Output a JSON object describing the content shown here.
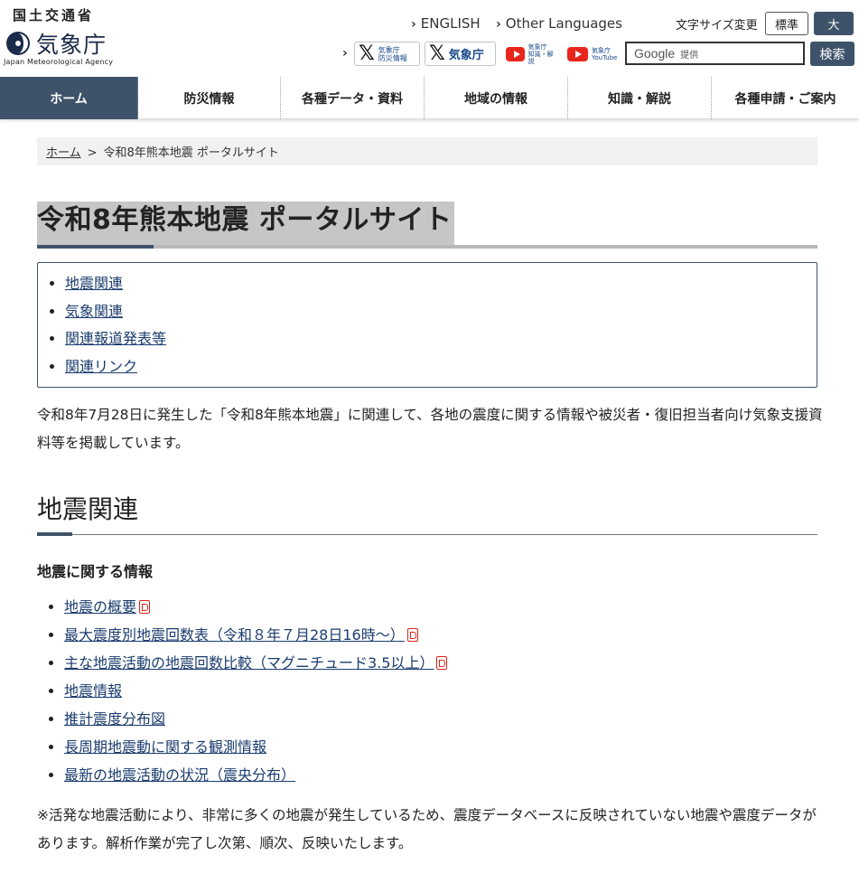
{
  "header": {
    "ministry": "国土交通省",
    "agency_name": "気象庁",
    "agency_english": "Japan Meteorological Agency",
    "english_link": "ENGLISH",
    "other_languages_link": "Other Languages",
    "font_size_label": "文字サイズ変更",
    "font_standard": "標準",
    "font_large": "大",
    "sns": [
      {
        "icon": "x-icon",
        "label_line1": "気象庁",
        "label_line2": "防災情報"
      },
      {
        "icon": "x-icon",
        "label": "気象庁"
      },
      {
        "icon": "youtube-icon",
        "label_line1": "気象庁",
        "label_line2": "知識・解説"
      },
      {
        "icon": "youtube-icon",
        "label_line1": "気象庁",
        "label_line2": "YouTube"
      }
    ],
    "search_google": "Google",
    "search_provided": "提供",
    "search_button": "検索"
  },
  "nav": [
    {
      "label": "ホーム",
      "active": true
    },
    {
      "label": "防災情報"
    },
    {
      "label": "各種データ・資料"
    },
    {
      "label": "地域の情報"
    },
    {
      "label": "知識・解説"
    },
    {
      "label": "各種申請・ご案内"
    }
  ],
  "breadcrumb": {
    "home": "ホーム",
    "separator": ">",
    "current": "令和8年熊本地震 ポータルサイト"
  },
  "page_title": "令和8年熊本地震 ポータルサイト",
  "toc": [
    "地震関連",
    "気象関連",
    "関連報道発表等",
    "関連リンク"
  ],
  "intro": "令和8年7月28日に発生した「令和8年熊本地震」に関連して、各地の震度に関する情報や被災者・復旧担当者向け気象支援資料等を掲載しています。",
  "section": {
    "title": "地震関連",
    "subhead": "地震に関する情報",
    "items": [
      {
        "label": "地震の概要",
        "pdf": true
      },
      {
        "label": "最大震度別地震回数表（令和８年７月28日16時～）",
        "pdf": true
      },
      {
        "label": "主な地震活動の地震回数比較（マグニチュード3.5以上）",
        "pdf": true
      },
      {
        "label": "地震情報",
        "pdf": false
      },
      {
        "label": "推計震度分布図",
        "pdf": false
      },
      {
        "label": "長周期地震動に関する観測情報",
        "pdf": false
      },
      {
        "label": "最新の地震活動の状況（震央分布）",
        "pdf": false
      }
    ],
    "note": "※活発な地震活動により、非常に多くの地震が発生しているため、震度データベースに反映されていない地震や震度データがあります。解析作業が完了し次第、順次、反映いたします。"
  },
  "colors": {
    "nav_active": "#3e5369",
    "link": "#1a3c6e",
    "pdf_red": "#d9261c",
    "youtube_red": "#e8261d"
  }
}
